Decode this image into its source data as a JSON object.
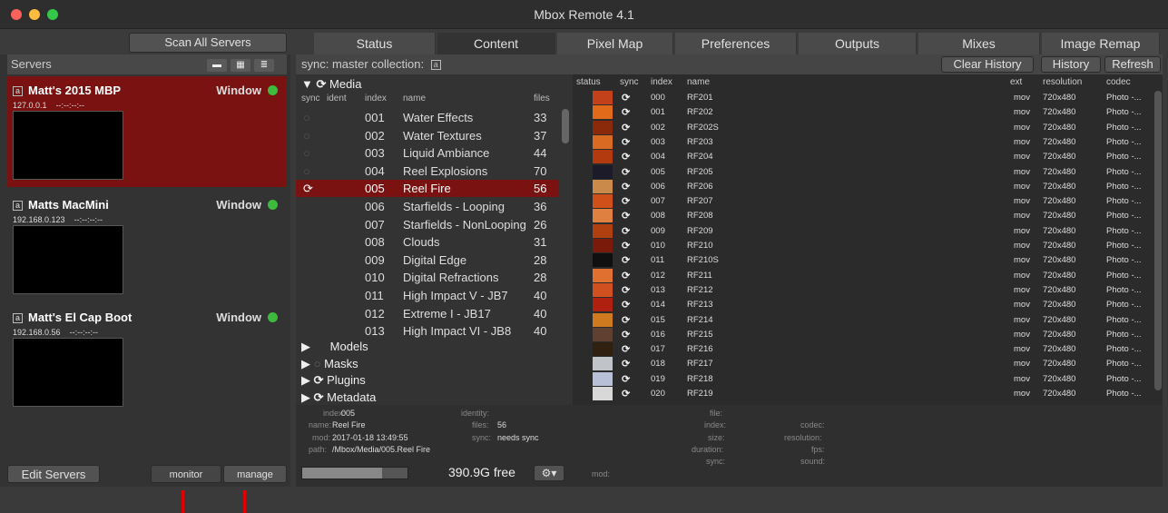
{
  "window": {
    "title": "Mbox Remote 4.1"
  },
  "toolbar": {
    "scan_label": "Scan All Servers"
  },
  "tabs": [
    "Status",
    "Content",
    "Pixel Map",
    "Preferences",
    "Outputs",
    "Mixes",
    "Image Remap"
  ],
  "left": {
    "header": "Servers",
    "view_buttons": [
      "▬",
      "▦",
      "≣"
    ],
    "servers": [
      {
        "name": "Matt's 2015 MBP",
        "ip": "127.0.0.1",
        "status": "--:--:--:--",
        "mode": "Window",
        "badge": "a"
      },
      {
        "name": "Matts MacMini",
        "ip": "192.168.0.123",
        "status": "--:--:--:--",
        "mode": "Window",
        "badge": "a"
      },
      {
        "name": "Matt's El Cap Boot",
        "ip": "192.168.0.56",
        "status": "--:--:--:--",
        "mode": "Window",
        "badge": "a"
      }
    ],
    "edit_label": "Edit Servers",
    "monitor_label": "monitor",
    "manage_label": "manage"
  },
  "content": {
    "sync_label": "sync: master collection:",
    "sync_badge": "a",
    "clear_history": "Clear History",
    "history": "History",
    "refresh": "Refresh",
    "media_group": "Media",
    "col_headers": [
      "sync",
      "ident",
      "index",
      "name",
      "files"
    ],
    "collections": [
      {
        "index": "001",
        "name": "Water Effects",
        "files": "33"
      },
      {
        "index": "002",
        "name": "Water Textures",
        "files": "37"
      },
      {
        "index": "003",
        "name": "Liquid Ambiance",
        "files": "44"
      },
      {
        "index": "004",
        "name": "Reel Explosions",
        "files": "70"
      },
      {
        "index": "005",
        "name": "Reel Fire",
        "files": "56"
      },
      {
        "index": "006",
        "name": "Starfields - Looping",
        "files": "36"
      },
      {
        "index": "007",
        "name": "Starfields - NonLooping",
        "files": "26"
      },
      {
        "index": "008",
        "name": "Clouds",
        "files": "31"
      },
      {
        "index": "009",
        "name": "Digital Edge",
        "files": "28"
      },
      {
        "index": "010",
        "name": "Digital Refractions",
        "files": "28"
      },
      {
        "index": "011",
        "name": "High Impact V - JB7",
        "files": "40"
      },
      {
        "index": "012",
        "name": "Extreme I - JB17",
        "files": "40"
      },
      {
        "index": "013",
        "name": "High Impact VI - JB8",
        "files": "40"
      }
    ],
    "groups": [
      "Models",
      "Masks",
      "Plugins",
      "Metadata"
    ],
    "info": {
      "index_l": "index:",
      "index_v": "005",
      "name_l": "name:",
      "name_v": "Reel Fire",
      "mod_l": "mod:",
      "mod_v": "2017-01-18 13:49:55",
      "path_l": "path:",
      "path_v": "/Mbox/Media/005.Reel Fire",
      "identity_l": "identity:",
      "files_l": "files:",
      "files_v": "56",
      "sync_l": "sync:",
      "sync_v": "needs sync",
      "file_l": "file:",
      "findex_l": "index:",
      "size_l": "size:",
      "duration_l": "duration:",
      "fsync_l": "sync:",
      "mod2_l": "mod:",
      "codec_l": "codec:",
      "resolution_l": "resolution:",
      "fps_l": "fps:",
      "sound_l": "sound:"
    },
    "free_space": "390.9G free",
    "media_headers": [
      "status",
      "sync",
      "index",
      "name",
      "ext",
      "resolution",
      "codec"
    ],
    "media": [
      {
        "index": "000",
        "name": "RF201",
        "ext": "mov",
        "res": "720x480",
        "codec": "Photo -..."
      },
      {
        "index": "001",
        "name": "RF202",
        "ext": "mov",
        "res": "720x480",
        "codec": "Photo -..."
      },
      {
        "index": "002",
        "name": "RF202S",
        "ext": "mov",
        "res": "720x480",
        "codec": "Photo -..."
      },
      {
        "index": "003",
        "name": "RF203",
        "ext": "mov",
        "res": "720x480",
        "codec": "Photo -..."
      },
      {
        "index": "004",
        "name": "RF204",
        "ext": "mov",
        "res": "720x480",
        "codec": "Photo -..."
      },
      {
        "index": "005",
        "name": "RF205",
        "ext": "mov",
        "res": "720x480",
        "codec": "Photo -..."
      },
      {
        "index": "006",
        "name": "RF206",
        "ext": "mov",
        "res": "720x480",
        "codec": "Photo -..."
      },
      {
        "index": "007",
        "name": "RF207",
        "ext": "mov",
        "res": "720x480",
        "codec": "Photo -..."
      },
      {
        "index": "008",
        "name": "RF208",
        "ext": "mov",
        "res": "720x480",
        "codec": "Photo -..."
      },
      {
        "index": "009",
        "name": "RF209",
        "ext": "mov",
        "res": "720x480",
        "codec": "Photo -..."
      },
      {
        "index": "010",
        "name": "RF210",
        "ext": "mov",
        "res": "720x480",
        "codec": "Photo -..."
      },
      {
        "index": "011",
        "name": "RF210S",
        "ext": "mov",
        "res": "720x480",
        "codec": "Photo -..."
      },
      {
        "index": "012",
        "name": "RF211",
        "ext": "mov",
        "res": "720x480",
        "codec": "Photo -..."
      },
      {
        "index": "013",
        "name": "RF212",
        "ext": "mov",
        "res": "720x480",
        "codec": "Photo -..."
      },
      {
        "index": "014",
        "name": "RF213",
        "ext": "mov",
        "res": "720x480",
        "codec": "Photo -..."
      },
      {
        "index": "015",
        "name": "RF214",
        "ext": "mov",
        "res": "720x480",
        "codec": "Photo -..."
      },
      {
        "index": "016",
        "name": "RF215",
        "ext": "mov",
        "res": "720x480",
        "codec": "Photo -..."
      },
      {
        "index": "017",
        "name": "RF216",
        "ext": "mov",
        "res": "720x480",
        "codec": "Photo -..."
      },
      {
        "index": "018",
        "name": "RF217",
        "ext": "mov",
        "res": "720x480",
        "codec": "Photo -..."
      },
      {
        "index": "019",
        "name": "RF218",
        "ext": "mov",
        "res": "720x480",
        "codec": "Photo -..."
      },
      {
        "index": "020",
        "name": "RF219",
        "ext": "mov",
        "res": "720x480",
        "codec": "Photo -..."
      }
    ]
  },
  "colors": {
    "selected": "#7a1212",
    "accent_green": "#3dbb3d",
    "annotation_red": "#e00000"
  }
}
